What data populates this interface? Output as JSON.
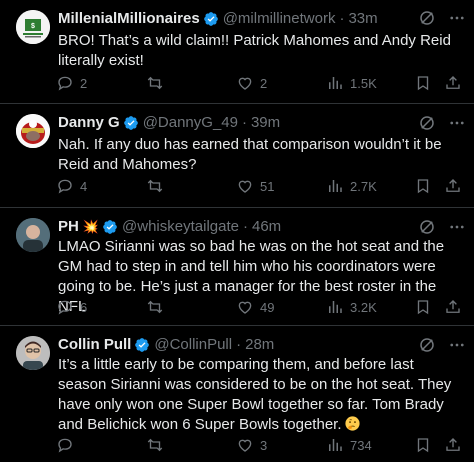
{
  "tweets": [
    {
      "name": "MillenialMillionaires",
      "handle": "@milmillinetwork",
      "separator": "·",
      "time": "33m",
      "text": "BRO! That’s a wild claim!! Patrick Mahomes and Andy Reid literally exist!",
      "replies": "2",
      "retweets": "",
      "likes": "2",
      "views": "1.5K"
    },
    {
      "name": "Danny G",
      "handle": "@DannyG_49",
      "separator": "·",
      "time": "39m",
      "text": "Nah. If any duo has earned that comparison wouldn’t it be Reid and Mahomes?",
      "replies": "4",
      "retweets": "",
      "likes": "51",
      "views": "2.7K"
    },
    {
      "name": "PH",
      "name_emoji": "💥",
      "handle": "@whiskeytailgate",
      "separator": "·",
      "time": "46m",
      "text": "LMAO Sirianni was so bad he was on the hot seat and the GM had to step in and tell him who his coordinators were going to be. He’s just a manager for the best roster in the NFL",
      "replies": "6",
      "retweets": "",
      "likes": "49",
      "views": "3.2K"
    },
    {
      "name": "Collin Pull",
      "handle": "@CollinPull",
      "separator": "·",
      "time": "28m",
      "text": "It’s a little early to be comparing them, and before last season Sirianni was considered to be on the hot seat. They have only won one Super Bowl together so far. Tom Brady and Belichick won 6 Super Bowls together.",
      "replies": "",
      "retweets": "",
      "likes": "3",
      "views": "734"
    }
  ],
  "colors": {
    "background": "#000000",
    "text": "#e7e9ea",
    "muted": "#71767b",
    "verified": "#1d9bf0",
    "divider": "#2f3336"
  },
  "icons": [
    "grok-icon",
    "reply-icon",
    "retweet-icon",
    "like-icon",
    "views-icon",
    "bookmark-icon",
    "share-icon",
    "verified-badge-icon",
    "thinking-face-emoji"
  ]
}
